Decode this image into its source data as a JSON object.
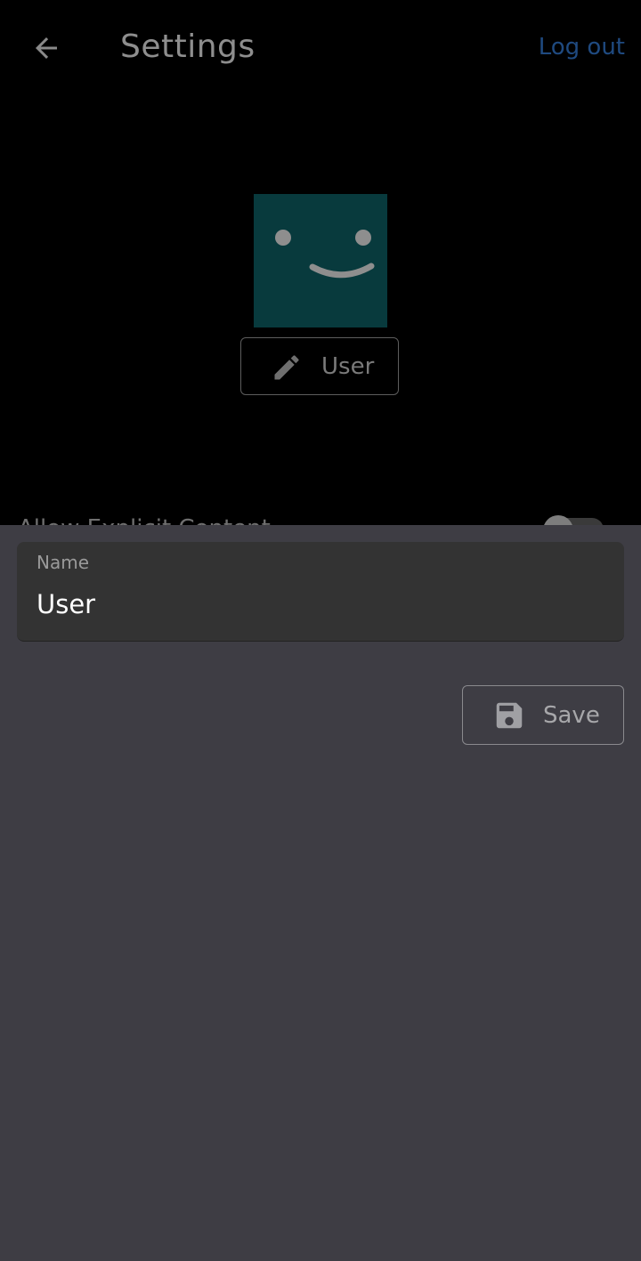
{
  "header": {
    "title": "Settings",
    "logout_label": "Log out",
    "back_icon": "arrow-back-icon"
  },
  "profile": {
    "avatar_icon": "smiley-face-icon",
    "edit_icon": "pencil-icon",
    "name_button_label": "User"
  },
  "settings": {
    "explicit_content_label": "Allow Explicit Content",
    "explicit_content_enabled": false
  },
  "sheet": {
    "name_field_label": "Name",
    "name_field_value": "User",
    "save_label": "Save",
    "save_icon": "floppy-disk-icon"
  },
  "colors": {
    "background": "#000000",
    "sheet_background": "#3e3d44",
    "field_background": "#333333",
    "avatar_background": "#083a3d",
    "logout_link": "#1f4a80"
  }
}
